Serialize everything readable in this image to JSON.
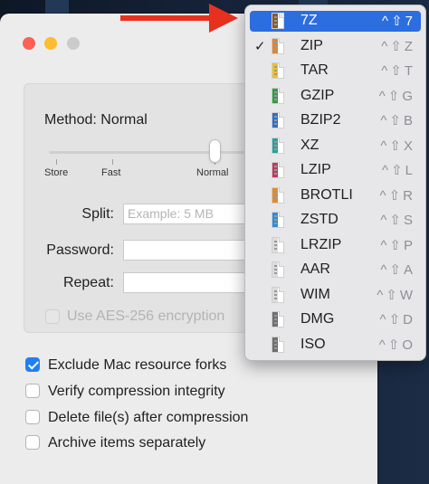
{
  "theme": {
    "accent": "#2c6de0",
    "checkbox_accent": "#1f80f5",
    "arrow_color": "#e8301f"
  },
  "window": {
    "traffic_lights": [
      "#fe5f57",
      "#febc2e",
      "#cbcbcb"
    ]
  },
  "compression": {
    "method_label": "Method: Normal",
    "slider_ticks": [
      "Store",
      "Fast",
      "Normal"
    ],
    "slider_level": "Normal"
  },
  "fields": {
    "split_label": "Split:",
    "split_placeholder": "Example: 5 MB",
    "password_label": "Password:",
    "repeat_label": "Repeat:"
  },
  "aes": {
    "label": "Use AES-256 encryption",
    "checked": false,
    "disabled": true
  },
  "options": [
    {
      "label": "Exclude Mac resource forks",
      "checked": true
    },
    {
      "label": "Verify compression integrity",
      "checked": false
    },
    {
      "label": "Delete file(s) after compression",
      "checked": false
    },
    {
      "label": "Archive items separately",
      "checked": false
    }
  ],
  "format_menu": {
    "items": [
      {
        "name": "7Z",
        "shortcut": "^⇧7",
        "icon_color": "#8a5a2b",
        "selected": true,
        "checked": false
      },
      {
        "name": "ZIP",
        "shortcut": "^⇧Z",
        "icon_color": "#e8822a",
        "selected": false,
        "checked": true
      },
      {
        "name": "TAR",
        "shortcut": "^⇧T",
        "icon_color": "#f2c21b",
        "selected": false,
        "checked": false
      },
      {
        "name": "GZIP",
        "shortcut": "^⇧G",
        "icon_color": "#2f9e41",
        "selected": false,
        "checked": false
      },
      {
        "name": "BZIP2",
        "shortcut": "^⇧B",
        "icon_color": "#2a6fd1",
        "selected": false,
        "checked": false
      },
      {
        "name": "XZ",
        "shortcut": "^⇧X",
        "icon_color": "#25a39a",
        "selected": false,
        "checked": false
      },
      {
        "name": "LZIP",
        "shortcut": "^⇧L",
        "icon_color": "#c4375e",
        "selected": false,
        "checked": false
      },
      {
        "name": "BROTLI",
        "shortcut": "^⇧R",
        "icon_color": "#e88b24",
        "selected": false,
        "checked": false
      },
      {
        "name": "ZSTD",
        "shortcut": "^⇧S",
        "icon_color": "#2b8de0",
        "selected": false,
        "checked": false
      },
      {
        "name": "LRZIP",
        "shortcut": "^⇧P",
        "icon_color": "#dcdcdc",
        "selected": false,
        "checked": false
      },
      {
        "name": "AAR",
        "shortcut": "^⇧A",
        "icon_color": "#dcdcdc",
        "selected": false,
        "checked": false
      },
      {
        "name": "WIM",
        "shortcut": "^⇧W",
        "icon_color": "#dcdcdc",
        "selected": false,
        "checked": false
      },
      {
        "name": "DMG",
        "shortcut": "^⇧D",
        "icon_color": "#6f6f6f",
        "selected": false,
        "checked": false
      },
      {
        "name": "ISO",
        "shortcut": "^⇧O",
        "icon_color": "#6f6f6f",
        "selected": false,
        "checked": false
      }
    ]
  }
}
